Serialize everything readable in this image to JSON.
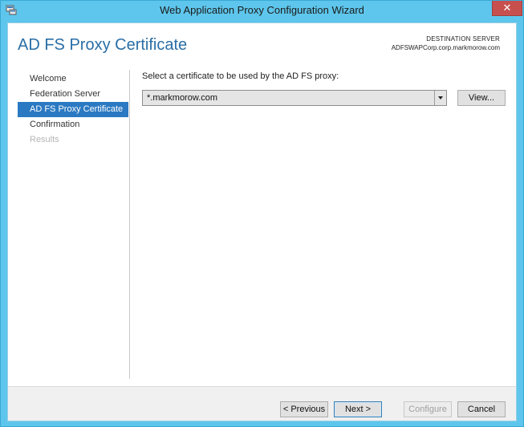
{
  "window": {
    "title": "Web Application Proxy Configuration Wizard",
    "close_glyph": "✕"
  },
  "header": {
    "page_title": "AD FS Proxy Certificate",
    "destination_label": "DESTINATION SERVER",
    "destination_value": "ADFSWAPCorp.corp.markmorow.com"
  },
  "nav": {
    "items": [
      {
        "label": "Welcome",
        "state": "normal"
      },
      {
        "label": "Federation Server",
        "state": "normal"
      },
      {
        "label": "AD FS Proxy Certificate",
        "state": "active"
      },
      {
        "label": "Confirmation",
        "state": "normal"
      },
      {
        "label": "Results",
        "state": "disabled"
      }
    ]
  },
  "main": {
    "prompt": "Select a certificate to be used by the AD FS proxy:",
    "certificate_selected": "*.markmorow.com",
    "view_button": "View..."
  },
  "footer": {
    "previous": "< Previous",
    "next": "Next >",
    "configure": "Configure",
    "cancel": "Cancel"
  },
  "colors": {
    "frame": "#5ec6ec",
    "accent": "#2b79c2",
    "title_text": "#2a6ea6"
  }
}
